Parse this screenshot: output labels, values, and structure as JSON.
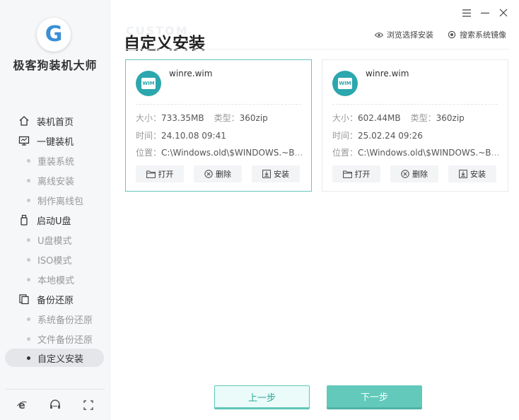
{
  "app": {
    "name": "极客狗装机大师",
    "logo_letter": "G"
  },
  "sidebar": {
    "items": [
      {
        "type": "main",
        "label": "装机首页",
        "icon": "home-icon"
      },
      {
        "type": "main",
        "label": "一键装机",
        "icon": "monitor-icon"
      },
      {
        "type": "sub",
        "label": "重装系统"
      },
      {
        "type": "sub",
        "label": "离线安装"
      },
      {
        "type": "sub",
        "label": "制作离线包"
      },
      {
        "type": "main",
        "label": "启动U盘",
        "icon": "usb-icon"
      },
      {
        "type": "sub",
        "label": "U盘模式"
      },
      {
        "type": "sub",
        "label": "ISO模式"
      },
      {
        "type": "sub",
        "label": "本地模式"
      },
      {
        "type": "main",
        "label": "备份还原",
        "icon": "backup-icon"
      },
      {
        "type": "sub",
        "label": "系统备份还原"
      },
      {
        "type": "sub",
        "label": "文件备份还原"
      },
      {
        "type": "sub",
        "label": "自定义安装",
        "active": true
      }
    ],
    "footer_icons": [
      "ie-browser-icon",
      "support-chat-icon",
      "fullscreen-icon"
    ]
  },
  "header": {
    "ghost_text": "CUSTOM",
    "title": "自定义安装",
    "links": {
      "browse": "浏览选择安装",
      "search": "搜索系统镜像"
    }
  },
  "cards": [
    {
      "filename": "winre.wim",
      "badge": "WIM",
      "size_label": "大小：",
      "size": "733.35MB",
      "type_label": "类型：",
      "type": "360zip",
      "time_label": "时间：",
      "time": "24.10.08 09:41",
      "location_label": "位置：",
      "location": "C:\\Windows.old\\$WINDOWS.~BT...",
      "open": "打开",
      "delete": "删除",
      "install": "安装",
      "selected": true
    },
    {
      "filename": "winre.wim",
      "badge": "WIM",
      "size_label": "大小：",
      "size": "602.44MB",
      "type_label": "类型：",
      "type": "360zip",
      "time_label": "时间：",
      "time": "25.02.24 09:26",
      "location_label": "位置：",
      "location": "C:\\Windows.old\\$WINDOWS.~BT...",
      "open": "打开",
      "delete": "删除",
      "install": "安装",
      "selected": false
    }
  ],
  "buttons": {
    "prev": "上一步",
    "next": "下一步"
  },
  "colors": {
    "accent": "#62c9bb",
    "selected_border": "#67c7ba",
    "badge": "#2ca7ad"
  }
}
